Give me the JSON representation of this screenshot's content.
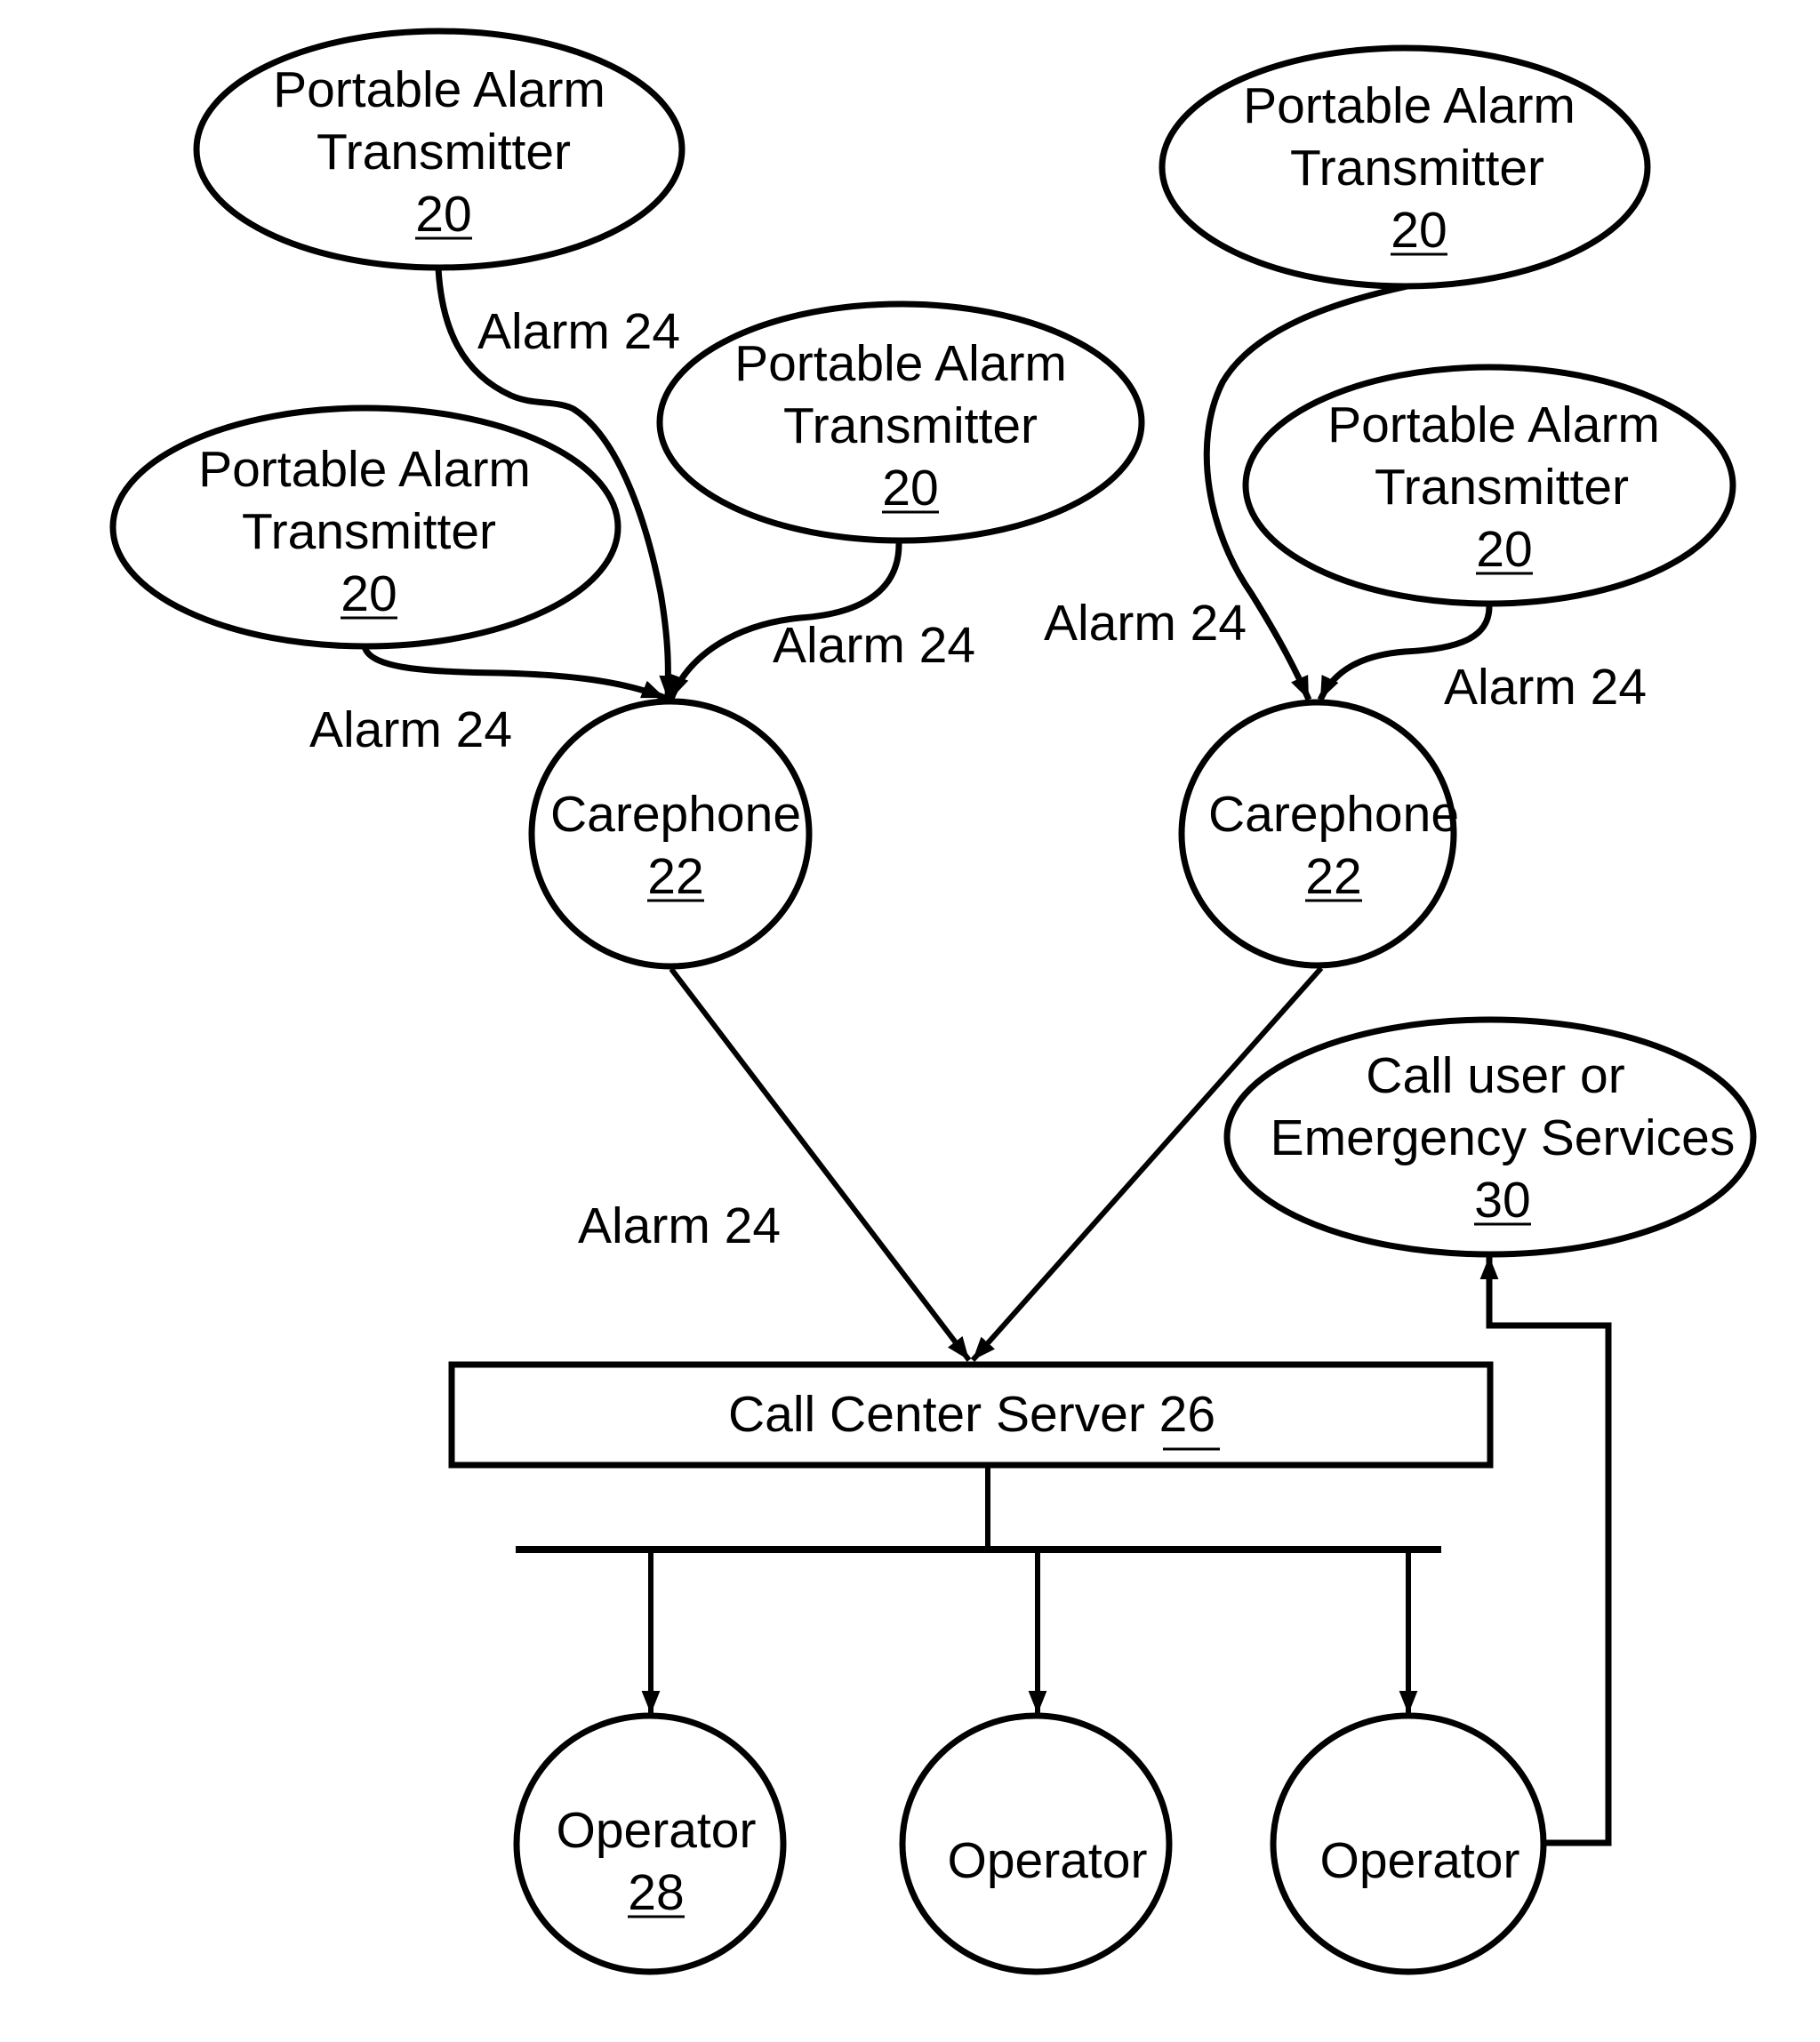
{
  "diagram": {
    "colors": {
      "stroke": "#000000",
      "background": "#ffffff"
    },
    "nodes": {
      "transmitter_a": {
        "lines": [
          "Portable Alarm",
          "Transmitter"
        ],
        "ref": "20"
      },
      "transmitter_b": {
        "lines": [
          "Portable Alarm",
          "Transmitter"
        ],
        "ref": "20"
      },
      "transmitter_c": {
        "lines": [
          "Portable Alarm",
          "Transmitter"
        ],
        "ref": "20"
      },
      "transmitter_d": {
        "lines": [
          "Portable Alarm",
          "Transmitter"
        ],
        "ref": "20"
      },
      "transmitter_e": {
        "lines": [
          "Portable Alarm",
          "Transmitter"
        ],
        "ref": "20"
      },
      "carephone_left": {
        "lines": [
          "Carephone"
        ],
        "ref": "22"
      },
      "carephone_right": {
        "lines": [
          "Carephone"
        ],
        "ref": "22"
      },
      "emergency": {
        "lines": [
          "Call user or",
          "Emergency Services"
        ],
        "ref": "30"
      },
      "server": {
        "label": "Call Center Server ",
        "ref": "26"
      },
      "operator_1": {
        "lines": [
          "Operator"
        ],
        "ref": "28"
      },
      "operator_2": {
        "lines": [
          "Operator"
        ],
        "ref": ""
      },
      "operator_3": {
        "lines": [
          "Operator"
        ],
        "ref": ""
      }
    },
    "edge_labels": {
      "a_to_carephone_left": "Alarm 24",
      "b_to_carephone_left": "Alarm 24",
      "c_to_carephone_left": "Alarm 24",
      "d_to_carephone_right": "Alarm 24",
      "e_to_carephone_right": "Alarm 24",
      "carephones_to_server": "Alarm 24"
    },
    "edges": [
      {
        "from": "transmitter_a",
        "to": "carephone_left",
        "label": "Alarm 24"
      },
      {
        "from": "transmitter_b",
        "to": "carephone_left",
        "label": "Alarm 24"
      },
      {
        "from": "transmitter_c",
        "to": "carephone_left",
        "label": "Alarm 24"
      },
      {
        "from": "transmitter_d",
        "to": "carephone_right",
        "label": "Alarm 24"
      },
      {
        "from": "transmitter_e",
        "to": "carephone_right",
        "label": "Alarm 24"
      },
      {
        "from": "carephone_left",
        "to": "server",
        "label": "Alarm 24"
      },
      {
        "from": "carephone_right",
        "to": "server",
        "label": ""
      },
      {
        "from": "server",
        "to": "operator_1",
        "label": ""
      },
      {
        "from": "server",
        "to": "operator_2",
        "label": ""
      },
      {
        "from": "server",
        "to": "operator_3",
        "label": ""
      },
      {
        "from": "operator_3",
        "to": "emergency",
        "label": ""
      }
    ]
  }
}
